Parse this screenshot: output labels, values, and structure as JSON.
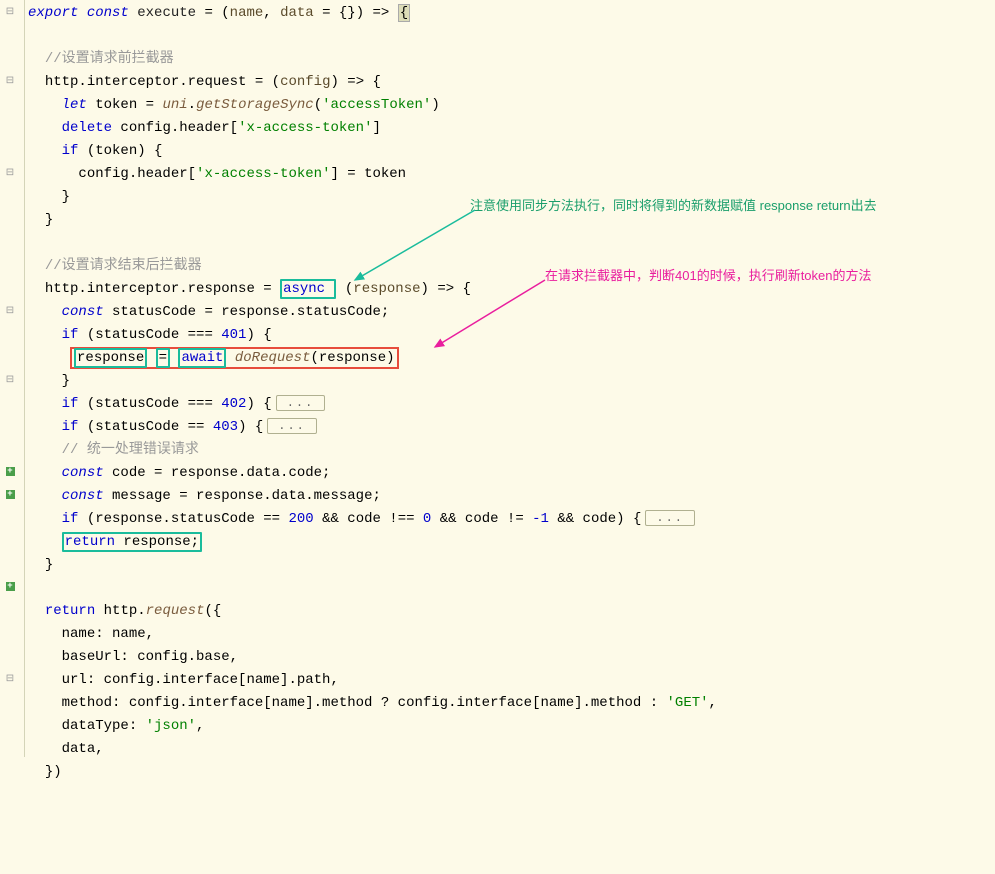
{
  "gutter": [
    "minus",
    "",
    "",
    "minus",
    "",
    "",
    "",
    "minus",
    "",
    "",
    "",
    "",
    "",
    "minus",
    "",
    "",
    "minus",
    "",
    "",
    "",
    "plus",
    "plus",
    "",
    "",
    "",
    "plus",
    "",
    "",
    "",
    "minus",
    "",
    "",
    "",
    "",
    "",
    "",
    "",
    ""
  ],
  "code": {
    "l1_export": "export",
    "l1_const": "const",
    "l1_execute": "execute",
    "l1_eq": " = (",
    "l1_name": "name",
    "l1_c1": ", ",
    "l1_data": "data",
    "l1_eq2": " = {}) => ",
    "l1_brace": "{",
    "l3_comment": "//设置请求前拦截器",
    "l4_a": "http.interceptor.request = (",
    "l4_config": "config",
    "l4_b": ") => {",
    "l5_let": "let",
    "l5_token": " token = ",
    "l5_uni": "uni",
    "l5_dot": ".",
    "l5_fn": "getStorageSync",
    "l5_p1": "(",
    "l5_str": "'accessToken'",
    "l5_p2": ")",
    "l6_a": "delete",
    "l6_b": " config.header[",
    "l6_str": "'x-access-token'",
    "l6_c": "]",
    "l7_if": "if",
    "l7_a": " (token) {",
    "l8_a": "config.header[",
    "l8_str": "'x-access-token'",
    "l8_b": "] = token",
    "l9": "}",
    "l10": "}",
    "l12_comment": "//设置请求结束后拦截器",
    "l13_a": "http.interceptor.response = ",
    "l13_async": "async",
    "l13_b": " (",
    "l13_resp": "response",
    "l13_c": ") => {",
    "l14_const": "const",
    "l14_a": " statusCode = response.statusCode;",
    "l15_if": "if",
    "l15_a": " (statusCode === ",
    "l15_num": "401",
    "l15_b": ") {",
    "l16_resp": "response",
    "l16_sp": " ",
    "l16_eq": "=",
    "l16_sp2": " ",
    "l16_await": "await",
    "l16_sp3": " ",
    "l16_fn": "doRequest",
    "l16_a": "(response)",
    "l17": "}",
    "l18_if": "if",
    "l18_a": " (statusCode === ",
    "l18_num": "402",
    "l18_b": ") {",
    "l19_if": "if",
    "l19_a": " (statusCode == ",
    "l19_num": "403",
    "l19_b": ") {",
    "l20_comment": "// 统一处理错误请求",
    "l21_const": "const",
    "l21_a": " code = response.data.code;",
    "l22_const": "const",
    "l22_a": " message = response.data.message;",
    "l23_if": "if",
    "l23_a": " (response.statusCode == ",
    "l23_n1": "200",
    "l23_b": " && code !== ",
    "l23_n2": "0",
    "l23_c": " && code != ",
    "l23_n3": "-1",
    "l23_d": " && code) {",
    "l24_return": "return",
    "l24_a": " response;",
    "l25": "}",
    "l27_return": "return",
    "l27_a": " http.",
    "l27_fn": "request",
    "l27_b": "({",
    "l28_a": "name: name,",
    "l29_a": "baseUrl: config.base,",
    "l30_a": "url: config.interface[name].path,",
    "l31_a": "method: config.interface[name].method ? config.interface[name].method : ",
    "l31_str": "'GET'",
    "l31_b": ",",
    "l32_a": "dataType: ",
    "l32_str": "'json'",
    "l32_b": ",",
    "l33_a": "data,",
    "l34": "})"
  },
  "fold_dots": "...",
  "annotations": {
    "green": "注意使用同步方法执行，同时将得到的新数据赋值 response return出去",
    "pink": "在请求拦截器中，判断401的时候，执行刷新token的方法"
  }
}
